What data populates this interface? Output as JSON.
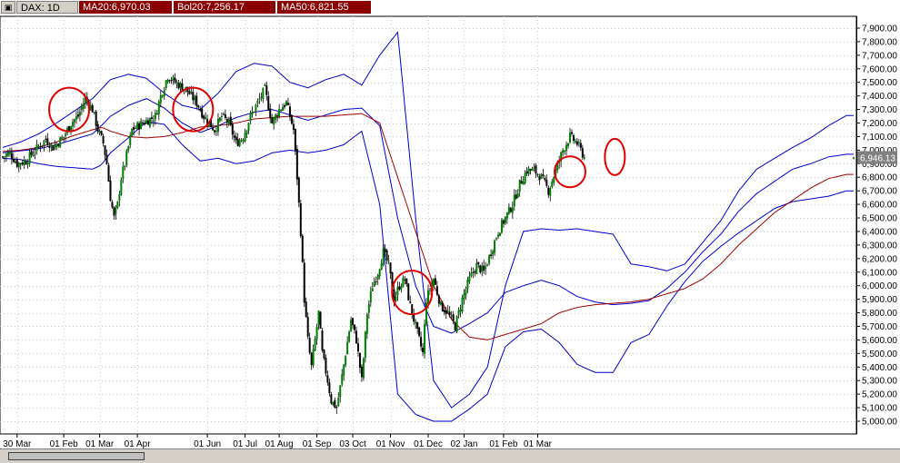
{
  "header": {
    "icon": "window-menu-icon",
    "symbol_label": "DAX: 1D",
    "ma20_label": "MA20:6,970.03",
    "bol20_label": "Bol20:7,256.17",
    "ma50_label": "MA50:6,821.55"
  },
  "colors": {
    "bollinger": "#0000cc",
    "ma50": "#a00000",
    "candle_up": "#008000",
    "candle_down": "#000000",
    "highlight_circle": "#e00000",
    "price_badge": "#808080"
  },
  "chart_data": {
    "type": "candlestick",
    "title": "DAX: 1D",
    "xlabel": "",
    "ylabel": "",
    "ylim": [
      4950,
      8000
    ],
    "yticks": [
      "7,900.00",
      "7,800.00",
      "7,700.00",
      "7,600.00",
      "7,500.00",
      "7,400.00",
      "7,300.00",
      "7,200.00",
      "7,100.00",
      "7,000.00",
      "6,900.00",
      "6,800.00",
      "6,700.00",
      "6,600.00",
      "6,500.00",
      "6,400.00",
      "6,300.00",
      "6,200.00",
      "6,100.00",
      "6,000.00",
      "5,900.00",
      "5,800.00",
      "5,700.00",
      "5,600.00",
      "5,500.00",
      "5,400.00",
      "5,300.00",
      "5,200.00",
      "5,100.00",
      "5,000.00"
    ],
    "ytick_values": [
      7900,
      7800,
      7700,
      7600,
      7500,
      7400,
      7300,
      7200,
      7100,
      7000,
      6900,
      6800,
      6700,
      6600,
      6500,
      6400,
      6300,
      6200,
      6100,
      6000,
      5900,
      5800,
      5700,
      5600,
      5500,
      5400,
      5300,
      5200,
      5100,
      5000
    ],
    "xticks": [
      "30 Mar",
      "01 Feb",
      "01 Mar",
      "01 Apr",
      "01 Jun",
      "01 Jul",
      "01 Aug",
      "01 Sep",
      "03 Oct",
      "01 Nov",
      "01 Dec",
      "02 Jan",
      "01 Feb",
      "01 Mar"
    ],
    "xtick_index": [
      8,
      34,
      54,
      75,
      114,
      135,
      154,
      175,
      195,
      216,
      237,
      257,
      279,
      298
    ],
    "last_price_label": "6,946.13",
    "last_price": 6946,
    "grid": true,
    "series": [
      {
        "name": "MA20",
        "values": [
          6980,
          6995,
          7010,
          7040,
          7080,
          7120,
          7180,
          7250,
          7330,
          7380,
          7310,
          7200,
          7130,
          7180,
          7240,
          7280,
          7300,
          7260,
          7220,
          7260,
          7300,
          7310,
          7180,
          6500,
          6000,
          5700,
          5650,
          5720,
          5800,
          5950,
          6000,
          6040,
          6000,
          5920,
          5880,
          5860,
          5870,
          5890,
          5980,
          6100,
          6250,
          6380,
          6550,
          6680,
          6770,
          6860,
          6900,
          6950,
          6970
        ]
      },
      {
        "name": "Bol20",
        "values": [
          7020,
          7060,
          7120,
          7200,
          7290,
          7380,
          7450,
          7520,
          7560,
          7530,
          7420,
          7330,
          7300,
          7420,
          7580,
          7640,
          7620,
          7500,
          7460,
          7520,
          7560,
          7480,
          7700,
          7870,
          6500,
          5300,
          5100,
          5200,
          5400,
          6000,
          6400,
          6420,
          6410,
          6420,
          6400,
          6380,
          6160,
          6140,
          6110,
          6160,
          6320,
          6480,
          6700,
          6860,
          6940,
          7020,
          7090,
          7180,
          7256
        ]
      },
      {
        "name": "Bol20 lower",
        "values": [
          6940,
          6930,
          6900,
          6880,
          6870,
          6860,
          6890,
          6980,
          7090,
          7210,
          7190,
          7040,
          6920,
          6940,
          6900,
          6920,
          6980,
          7000,
          6980,
          7000,
          7040,
          7140,
          6600,
          5200,
          5050,
          5000,
          5000,
          5090,
          5200,
          5550,
          5660,
          5680,
          5580,
          5420,
          5360,
          5360,
          5580,
          5640,
          5850,
          6030,
          6180,
          6290,
          6390,
          6480,
          6570,
          6620,
          6640,
          6660,
          6700
        ]
      },
      {
        "name": "MA50",
        "values": [
          6990,
          7000,
          7020,
          7060,
          7110,
          7150,
          7170,
          7140,
          7100,
          7090,
          7100,
          7130,
          7170,
          7180,
          7200,
          7230,
          7240,
          7250,
          7250,
          7250,
          7260,
          7270,
          7200,
          6800,
          6400,
          6000,
          5750,
          5620,
          5600,
          5640,
          5680,
          5720,
          5800,
          5840,
          5860,
          5870,
          5880,
          5900,
          5940,
          5980,
          6050,
          6160,
          6300,
          6420,
          6540,
          6630,
          6720,
          6790,
          6821
        ]
      }
    ],
    "band_index": [
      0,
      10,
      20,
      30,
      40,
      50,
      55,
      60,
      70,
      80,
      90,
      100,
      110,
      120,
      130,
      140,
      150,
      160,
      170,
      180,
      190,
      200,
      210,
      220,
      230,
      240,
      250,
      260,
      270,
      280,
      290,
      300,
      310,
      320,
      330,
      340,
      350,
      360,
      370,
      380,
      390,
      400,
      410,
      420,
      430,
      440,
      450,
      460,
      470
    ],
    "close_anchor_index": [
      0,
      4,
      8,
      13,
      18,
      24,
      28,
      34,
      38,
      42,
      46,
      50,
      53,
      56,
      58,
      60,
      62,
      64,
      66,
      68,
      72,
      78,
      85,
      88,
      92,
      96,
      102,
      108,
      112,
      118,
      122,
      126,
      130,
      134,
      138,
      142,
      146,
      150,
      154,
      158,
      162,
      164,
      166,
      168,
      170,
      172,
      174,
      176,
      178,
      181,
      183,
      186,
      188,
      191,
      194,
      197,
      200,
      203,
      206,
      209,
      212,
      215,
      218,
      221,
      224,
      227,
      230,
      234,
      236,
      240,
      244,
      248,
      252,
      256,
      260,
      264,
      268,
      272,
      276,
      280,
      284,
      288,
      292,
      296,
      300,
      304,
      308,
      312,
      316,
      320,
      324,
      328,
      332,
      336,
      340,
      344,
      348,
      352,
      356,
      360,
      364,
      368,
      372,
      376,
      380,
      384,
      388,
      392,
      396,
      400,
      404,
      408,
      412,
      416,
      420,
      424,
      428,
      432,
      436,
      440,
      444,
      448,
      452,
      456,
      460,
      464,
      468,
      472
    ],
    "close_anchor_values": [
      6950,
      6980,
      6900,
      6920,
      7000,
      7080,
      7020,
      7100,
      7200,
      7250,
      7380,
      7300,
      7150,
      7050,
      6900,
      6650,
      6500,
      6600,
      6800,
      6900,
      7150,
      7200,
      7250,
      7400,
      7550,
      7500,
      7450,
      7350,
      7250,
      7150,
      7250,
      7200,
      7050,
      7100,
      7250,
      7350,
      7450,
      7200,
      7300,
      7350,
      7150,
      6800,
      6400,
      5900,
      5600,
      5400,
      5600,
      5800,
      5500,
      5300,
      5150,
      5100,
      5250,
      5500,
      5750,
      5600,
      5300,
      5800,
      6000,
      6100,
      6250,
      6150,
      5900,
      6000,
      6050,
      5850,
      5700,
      5500,
      5900,
      6050,
      5850,
      5800,
      5700,
      5900,
      6050,
      6150,
      6100,
      6250,
      6400,
      6500,
      6600,
      6750,
      6850,
      6850,
      6800,
      6700,
      6850,
      7000,
      7100,
      7050,
      6946
    ]
  },
  "annotations": {
    "circles": [
      {
        "x_index": 37,
        "y_value": 7300
      },
      {
        "x_index": 106,
        "y_value": 7300
      },
      {
        "x_index": 228,
        "y_value": 5950
      },
      {
        "x_index": 316,
        "y_value": 6840
      },
      {
        "x_index": 341,
        "y_value": 6950
      }
    ]
  }
}
